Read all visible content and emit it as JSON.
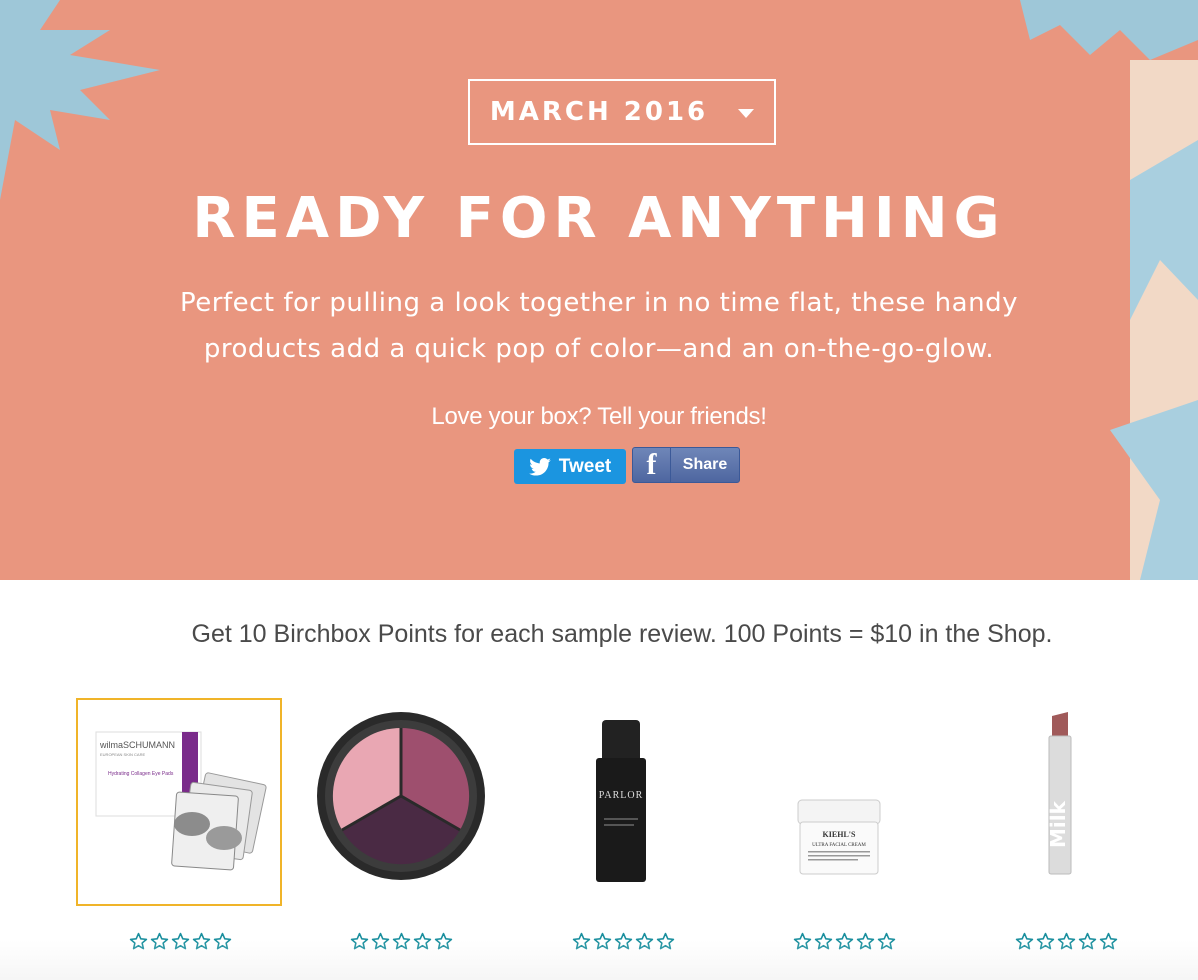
{
  "hero": {
    "month_selector": "MARCH 2016",
    "title": "READY FOR ANYTHING",
    "subtitle_line1": "Perfect for pulling a look together in no time flat, these handy",
    "subtitle_line2": "products add a quick pop of color—and an on-the-go-glow.",
    "share_prompt": "Love your box? Tell your friends!",
    "tweet_label": "Tweet",
    "share_label": "Share",
    "bg_color": "#e9967f"
  },
  "points_message": "Get 10 Birchbox Points for each sample review. 100 Points = $10 in the Shop.",
  "products": [
    {
      "brand_text": "wilmaSCHUMANN",
      "brand_sub": "EUROPEAN SKIN CARE",
      "name_text": "Hydrating Collagen Eye Pads",
      "rating": 0,
      "selected": true
    },
    {
      "rating": 0,
      "selected": false
    },
    {
      "brand_text": "PARLOR",
      "rating": 0,
      "selected": false
    },
    {
      "brand_text": "KIEHL'S",
      "name_text": "ULTRA FACIAL CREAM",
      "rating": 0,
      "selected": false
    },
    {
      "brand_text": "Milk",
      "rating": 0,
      "selected": false
    }
  ],
  "colors": {
    "star": "#1a8f9e",
    "selected_border": "#f0b429",
    "twitter": "#1b95e0",
    "facebook": "#4e66a0"
  }
}
